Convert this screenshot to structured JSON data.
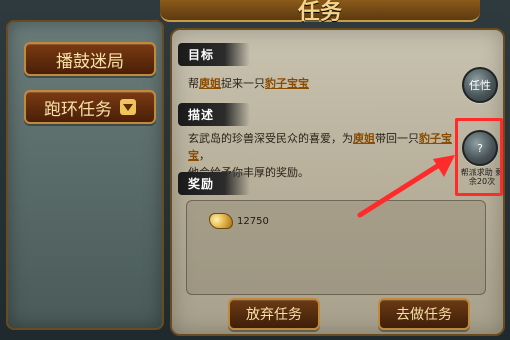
{
  "window": {
    "title": "任务"
  },
  "sidebar": {
    "tabs": [
      {
        "label": "播鼓迷局"
      },
      {
        "label": "跑环任务"
      }
    ]
  },
  "sections": {
    "target": {
      "label": "目标",
      "text_prefix": "帮",
      "npc": "庾姐",
      "text_mid": "捉来一只",
      "item": "豹子宝宝"
    },
    "description": {
      "label": "描述",
      "line1_prefix": "玄武岛的珍兽深受民众的喜爱，为",
      "npc": "庾姐",
      "line1_mid": "带回一只",
      "item": "豹子宝宝",
      "line1_suffix": "，",
      "line2": "他会给予你丰厚的奖励。"
    },
    "reward": {
      "label": "奖励",
      "gold_amount": "12750"
    }
  },
  "right_icons": {
    "icon_a_text": "任性",
    "icon_b_caption": "帮派求助 剩余20次"
  },
  "buttons": {
    "abandon": "放弃任务",
    "go": "去做任务"
  },
  "colors": {
    "highlight_red": "#ff2b2b",
    "button_text": "#f7e1a6",
    "npc_text": "#8a4c00"
  }
}
